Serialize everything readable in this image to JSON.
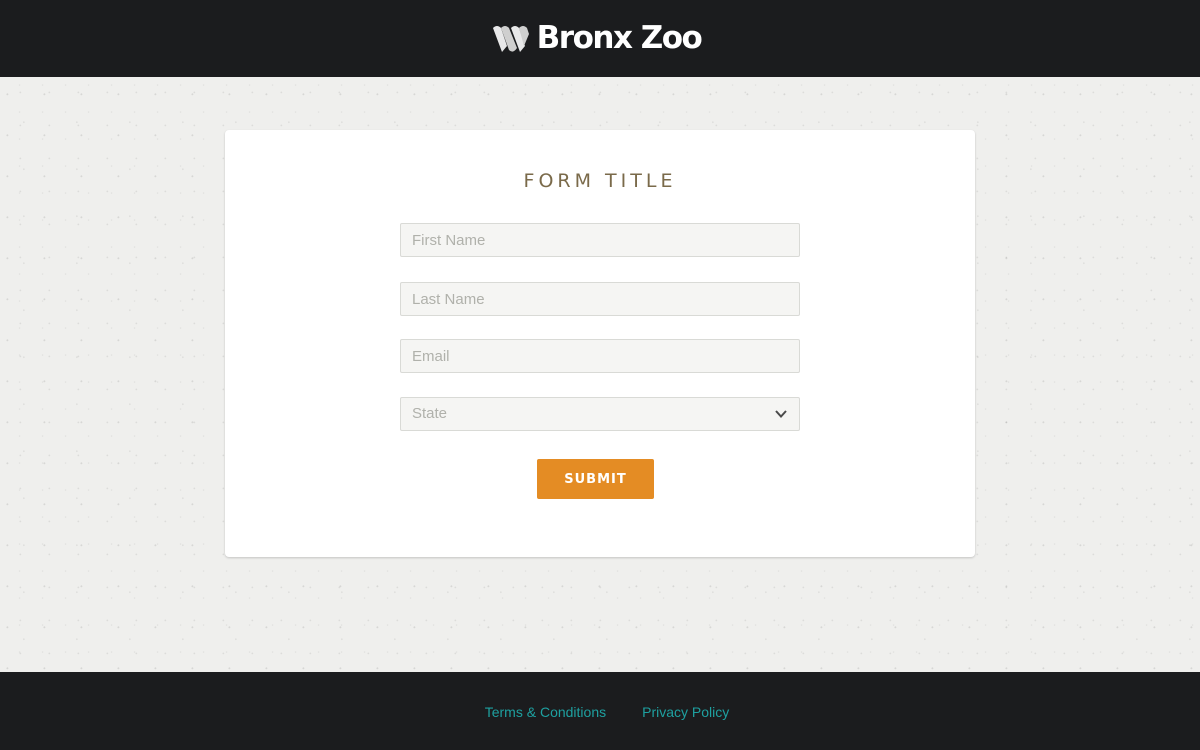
{
  "header": {
    "brand_name": "Bronx Zoo",
    "logo_icon": "wcs-logo-mark"
  },
  "form": {
    "title": "FORM TITLE",
    "first_name_placeholder": "First Name",
    "last_name_placeholder": "Last Name",
    "email_placeholder": "Email",
    "state_placeholder": "State",
    "state_icon": "chevron-down-icon",
    "submit_label": "SUBMIT"
  },
  "footer": {
    "links": [
      {
        "label": "Terms & Conditions"
      },
      {
        "label": "Privacy Policy"
      }
    ]
  },
  "colors": {
    "header_bg": "#1b1c1e",
    "page_bg": "#efefed",
    "title_text": "#7a6a4a",
    "submit_bg": "#e48c24",
    "footer_link": "#1ea0a0"
  }
}
